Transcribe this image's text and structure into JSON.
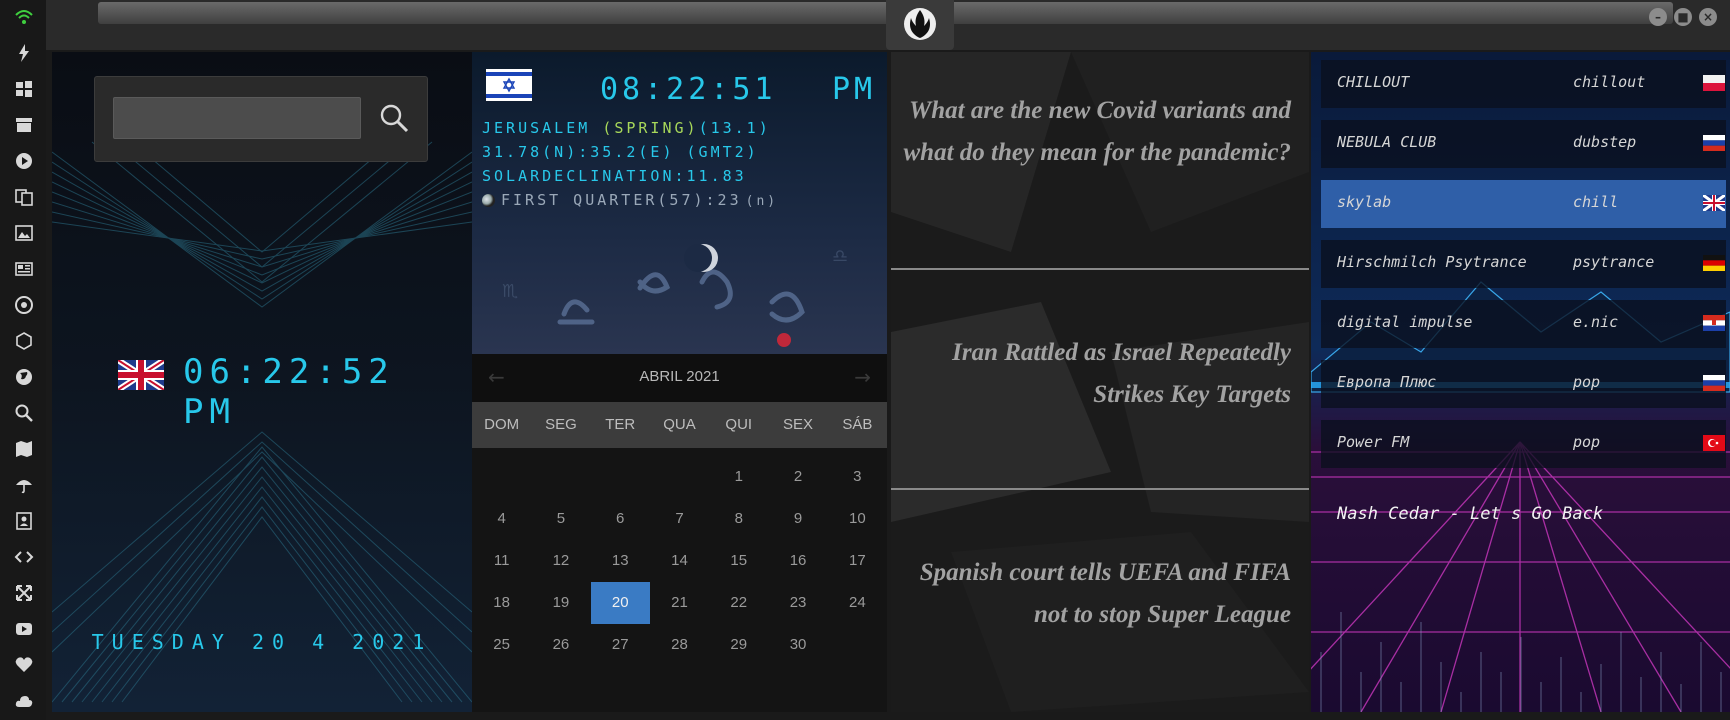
{
  "rail_icons": [
    "wifi-icon",
    "bolt-icon",
    "windows-icon",
    "archive-icon",
    "play-icon",
    "translate-icon",
    "image-icon",
    "news-icon",
    "settings-cog-icon",
    "hexagon-icon",
    "globe-icon",
    "search-icon",
    "map-icon",
    "umbrella-icon",
    "contacts-icon",
    "code-icon",
    "expand-icon",
    "youtube-icon",
    "heart-icon",
    "cloud-icon"
  ],
  "colors": {
    "accent": "#28c8ea",
    "highlight": "#a8d85a",
    "selected": "#3a7bc4",
    "station_active": "#2f5fa8"
  },
  "local_clock": {
    "time": "06:22:52 PM",
    "date": "TUESDAY 20 4 2021"
  },
  "search": {
    "value": "",
    "placeholder": ""
  },
  "world_clock": {
    "time": "08:22:51",
    "ampm": "PM",
    "city": "JERUSALEM",
    "season": "(SPRING)",
    "temp": "(13.1)",
    "coords": "31.78(N):35.2(E) (GMT2)",
    "solar": "SOLARDECLINATION:11.83",
    "moon": "FIRST QUARTER(57):23",
    "moon_suffix": "(n)"
  },
  "calendar": {
    "month": "ABRIL 2021",
    "weekdays": [
      "DOM",
      "SEG",
      "TER",
      "QUA",
      "QUI",
      "SEX",
      "SÁB"
    ],
    "weeks": [
      [
        "",
        "",
        "",
        "",
        "1",
        "2",
        "3"
      ],
      [
        "4",
        "5",
        "6",
        "7",
        "8",
        "9",
        "10"
      ],
      [
        "11",
        "12",
        "13",
        "14",
        "15",
        "16",
        "17"
      ],
      [
        "18",
        "19",
        "20",
        "21",
        "22",
        "23",
        "24"
      ],
      [
        "25",
        "26",
        "27",
        "28",
        "29",
        "30",
        ""
      ]
    ],
    "selected": "20"
  },
  "news": [
    "What are the new Covid variants and what do they mean for the pandemic?",
    "Iran Rattled as Israel Repeatedly Strikes Key Targets",
    "Spanish court tells UEFA and FIFA not to stop Super League"
  ],
  "radio": {
    "stations": [
      {
        "name": "CHILLOUT",
        "genre": "chillout",
        "flag": "poland-flag"
      },
      {
        "name": "NEBULA CLUB",
        "genre": "dubstep",
        "flag": "russia-flag"
      },
      {
        "name": "skylab",
        "genre": "chill",
        "flag": "uk-flag"
      },
      {
        "name": "Hirschmilch Psytrance",
        "genre": "psytrance",
        "flag": "germany-flag"
      },
      {
        "name": "digital impulse",
        "genre": "e.nic",
        "flag": "croatia-flag"
      },
      {
        "name": "Европа Плюс",
        "genre": "pop",
        "flag": "russia-flag"
      },
      {
        "name": "Power FM",
        "genre": "pop",
        "flag": "turkey-flag"
      }
    ],
    "active_index": 2,
    "now_playing": "Nash Cedar - Let s Go Back"
  }
}
